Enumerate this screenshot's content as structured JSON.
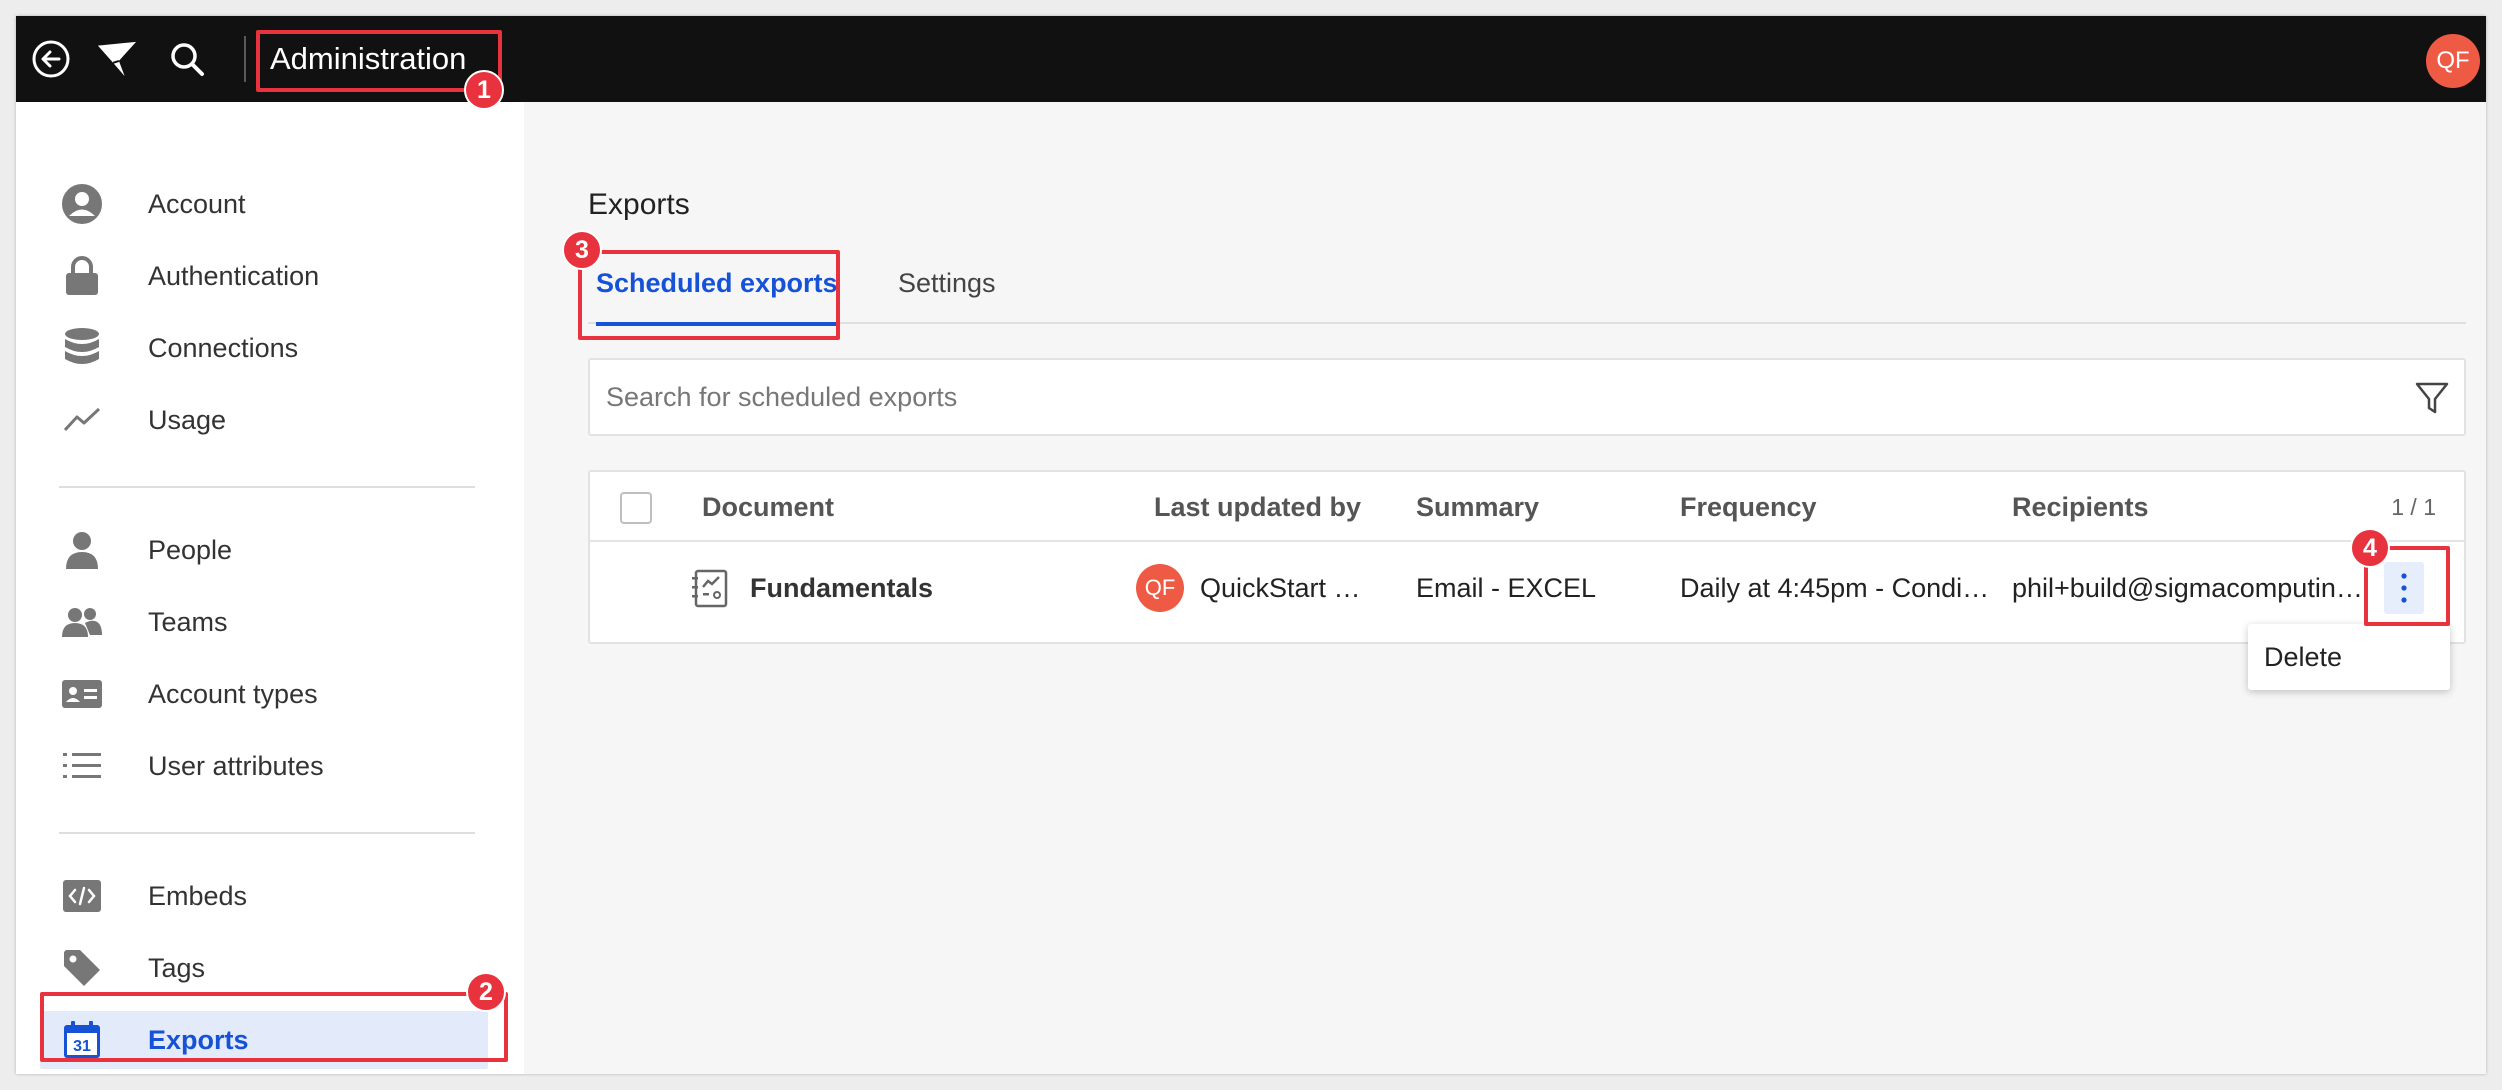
{
  "topbar": {
    "title": "Administration",
    "avatar_initials": "QF",
    "icons": [
      "back-icon",
      "sigma-logo-icon",
      "search-icon"
    ]
  },
  "sidebar": {
    "groups": [
      [
        {
          "label": "Account",
          "icon": "account-icon"
        },
        {
          "label": "Authentication",
          "icon": "lock-icon"
        },
        {
          "label": "Connections",
          "icon": "database-icon"
        },
        {
          "label": "Usage",
          "icon": "line-chart-icon"
        }
      ],
      [
        {
          "label": "People",
          "icon": "person-icon"
        },
        {
          "label": "Teams",
          "icon": "team-icon"
        },
        {
          "label": "Account types",
          "icon": "id-card-icon"
        },
        {
          "label": "User attributes",
          "icon": "list-icon"
        }
      ],
      [
        {
          "label": "Embeds",
          "icon": "code-icon"
        },
        {
          "label": "Tags",
          "icon": "tag-icon"
        },
        {
          "label": "Exports",
          "icon": "calendar-icon",
          "calendar_day": "31",
          "active": true
        }
      ]
    ]
  },
  "main": {
    "title": "Exports",
    "tabs": [
      {
        "label": "Scheduled exports",
        "active": true
      },
      {
        "label": "Settings",
        "active": false
      }
    ],
    "search": {
      "placeholder": "Search for scheduled exports",
      "value": ""
    },
    "table": {
      "columns": [
        "Document",
        "Last updated by",
        "Summary",
        "Frequency",
        "Recipients"
      ],
      "count": "1 / 1",
      "rows": [
        {
          "document": "Fundamentals",
          "avatar_initials": "QF",
          "last_updated_by": "QuickStart …",
          "summary": "Email - EXCEL",
          "frequency": "Daily at 4:45pm - Condi…",
          "recipients": "phil+build@sigmacomputin…"
        }
      ]
    },
    "row_menu": {
      "items": [
        "Delete"
      ]
    }
  },
  "annotations": [
    "1",
    "2",
    "3",
    "4"
  ],
  "colors": {
    "accent": "#1652d6",
    "highlight": "#e8333f",
    "avatar": "#ef5a45",
    "topbar": "#111111"
  }
}
